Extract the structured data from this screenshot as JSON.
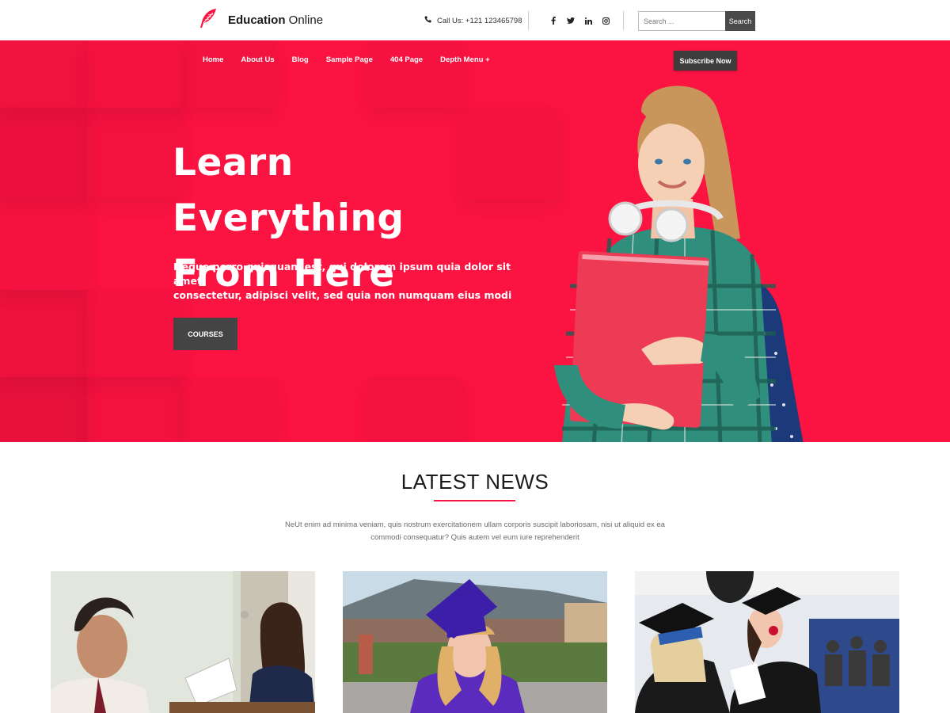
{
  "header": {
    "logo_bold": "Education",
    "logo_light": " Online",
    "call_text": "Call Us: +121 123465798",
    "socials": [
      "f",
      "t",
      "in",
      "ig"
    ],
    "search_placeholder": "Search ...",
    "search_button": "Search"
  },
  "nav": {
    "items": [
      "Home",
      "About Us",
      "Blog",
      "Sample Page",
      "404 Page",
      "Depth Menu +"
    ],
    "subscribe_label": "Subscribe Now"
  },
  "hero": {
    "title_line1": "Learn Everything",
    "title_line2": "From Here",
    "subtitle_line1": "Neque porro quisquam est, qui dolorem ipsum quia dolor sit amet,",
    "subtitle_line2": "consectetur, adipisci velit, sed quia non numquam eius modi",
    "cta_label": "COURSES"
  },
  "news": {
    "title": "LATEST NEWS",
    "desc_line1": "NeUt enim ad minima veniam, quis nostrum exercitationem ullam corporis suscipit laboriosam, nisi ut aliquid ex ea",
    "desc_line2": "commodi consequatur? Quis autem vel eum iure reprehenderit"
  },
  "colors": {
    "accent": "#fb1342",
    "dark_button": "#444444",
    "text_dark": "#1a1a1a"
  },
  "icons": [
    "feather-logo-icon",
    "phone-icon",
    "facebook-icon",
    "twitter-icon",
    "linkedin-icon",
    "instagram-icon"
  ]
}
